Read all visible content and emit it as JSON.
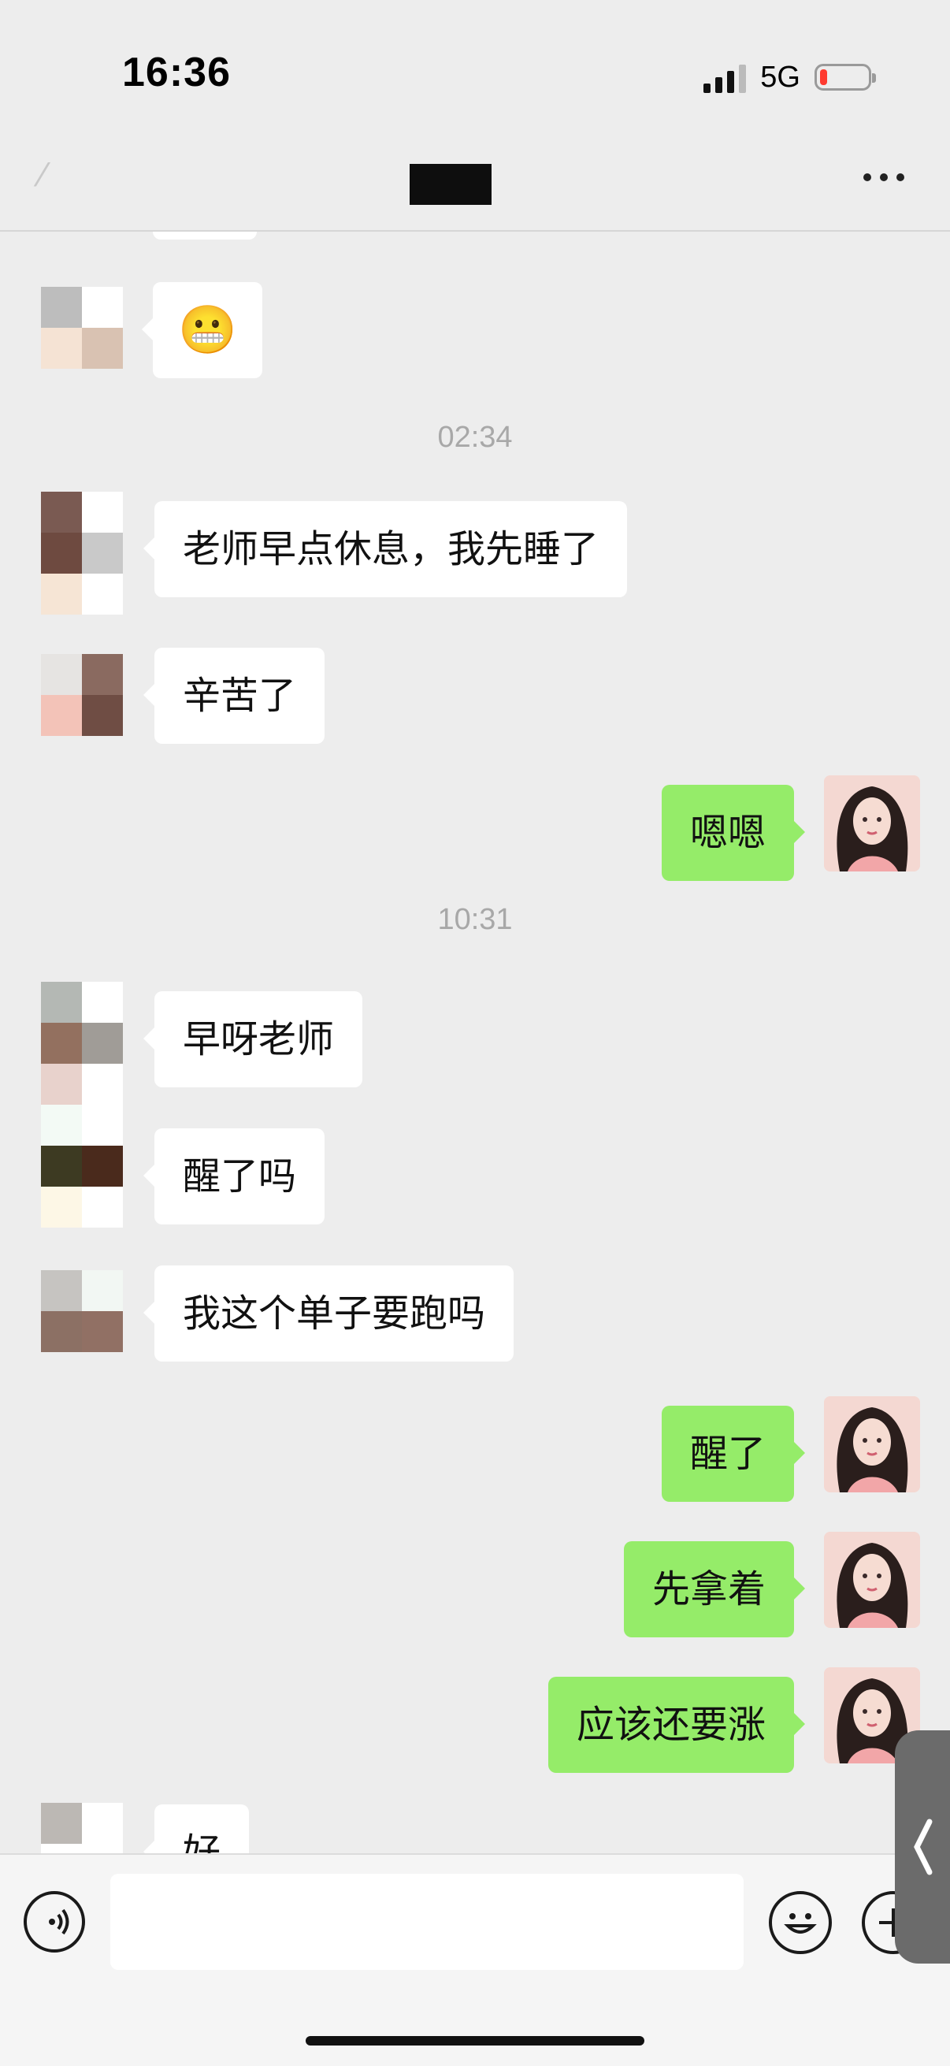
{
  "status_bar": {
    "time": "16:36",
    "network": "5G"
  },
  "header": {
    "title": "",
    "more_icon": "more-dots-icon"
  },
  "messages": [
    {
      "type": "time",
      "text": "02:34"
    },
    {
      "from": "other",
      "text": "老师早点休息，我先睡了"
    },
    {
      "from": "other",
      "text": "辛苦了"
    },
    {
      "from": "me",
      "text": "嗯嗯"
    },
    {
      "type": "time",
      "text": "10:31"
    },
    {
      "from": "other",
      "text": "早呀老师"
    },
    {
      "from": "other",
      "text": "醒了吗"
    },
    {
      "from": "other",
      "text": "我这个单子要跑吗"
    },
    {
      "from": "me",
      "text": "醒了"
    },
    {
      "from": "me",
      "text": "先拿着"
    },
    {
      "from": "me",
      "text": "应该还要涨"
    },
    {
      "from": "other",
      "text": "好"
    }
  ],
  "emoji_message": "😬",
  "input": {
    "placeholder": "",
    "value": ""
  },
  "colors": {
    "sent_bubble": "#95ec69",
    "received_bubble": "#ffffff",
    "background": "#ededed"
  }
}
